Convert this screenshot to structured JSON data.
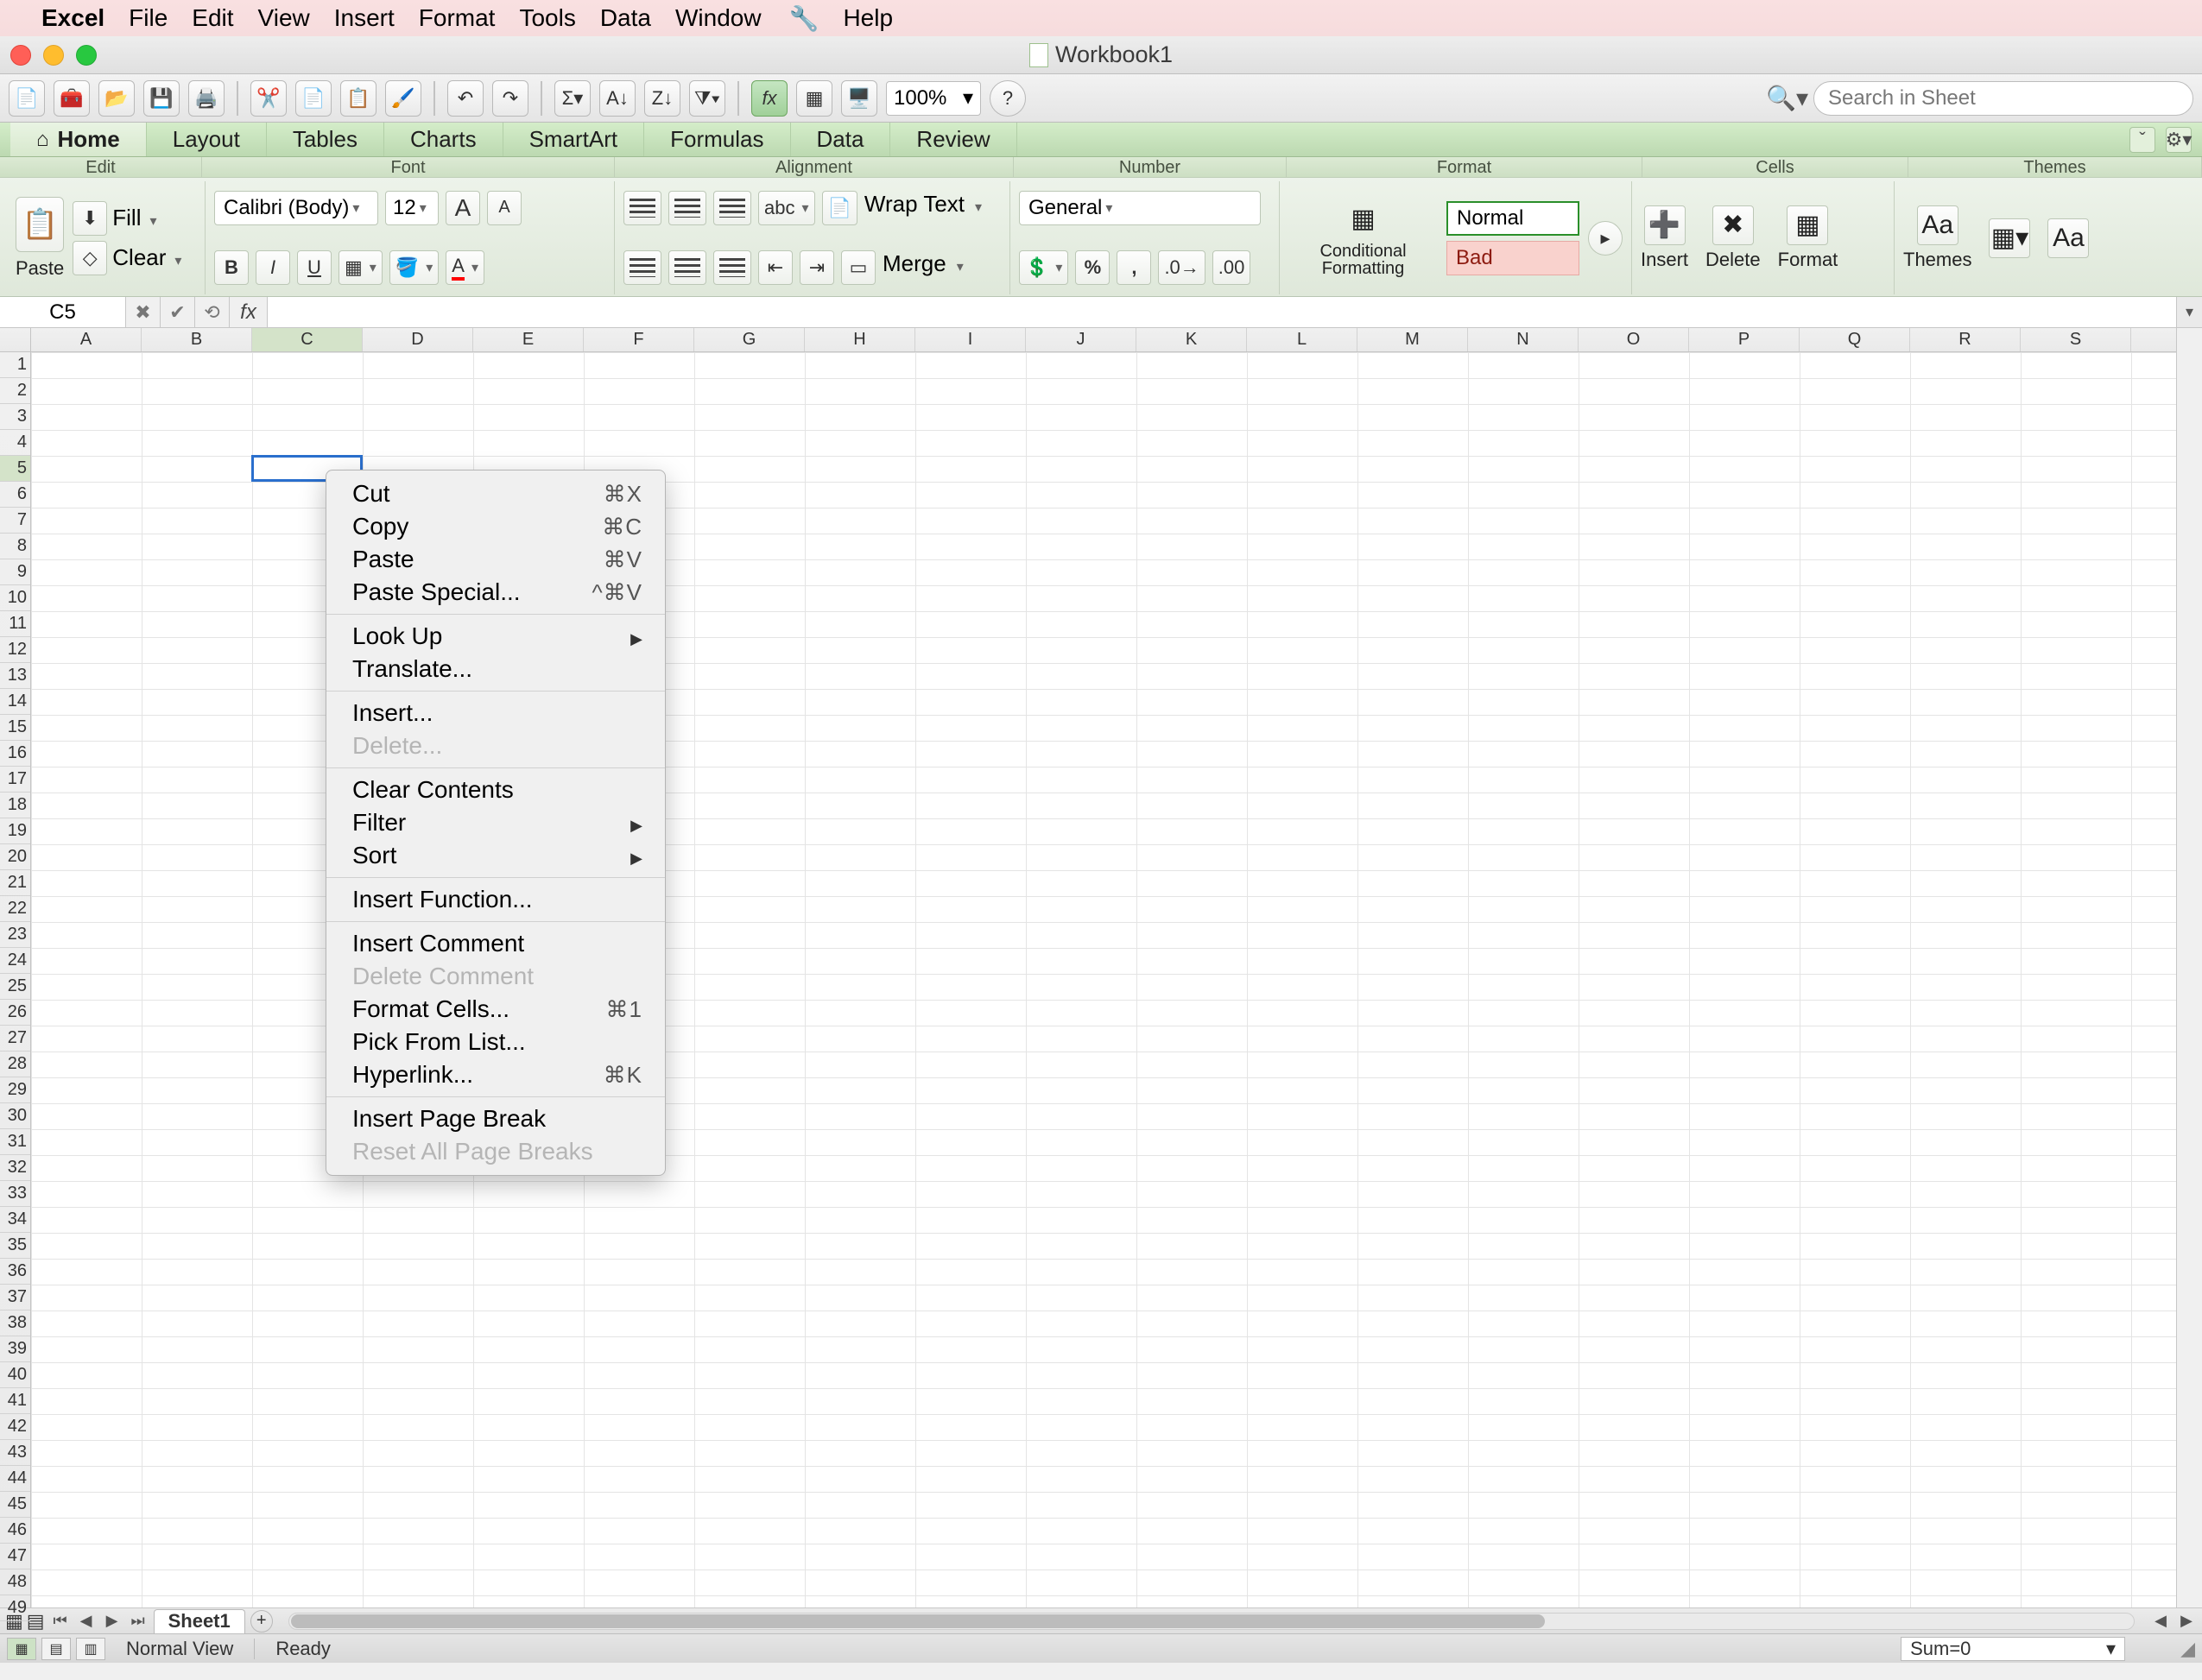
{
  "menubar": {
    "app": "Excel",
    "items": [
      "File",
      "Edit",
      "View",
      "Insert",
      "Format",
      "Tools",
      "Data",
      "Window"
    ],
    "help": "Help"
  },
  "window": {
    "title": "Workbook1"
  },
  "toolbar": {
    "zoom": "100%",
    "search_placeholder": "Search in Sheet"
  },
  "ribbon": {
    "tabs": [
      "Home",
      "Layout",
      "Tables",
      "Charts",
      "SmartArt",
      "Formulas",
      "Data",
      "Review"
    ],
    "active": "Home",
    "groups": {
      "edit": "Edit",
      "font": "Font",
      "alignment": "Alignment",
      "number": "Number",
      "format": "Format",
      "cells": "Cells",
      "themes": "Themes"
    },
    "edit": {
      "paste": "Paste",
      "fill": "Fill",
      "clear": "Clear"
    },
    "font": {
      "name": "Calibri (Body)",
      "size": "12"
    },
    "alignment": {
      "wrap": "Wrap Text",
      "merge": "Merge"
    },
    "number": {
      "format": "General"
    },
    "format": {
      "conditional": "Conditional Formatting",
      "normal": "Normal",
      "bad": "Bad"
    },
    "cells": {
      "insert": "Insert",
      "delete": "Delete",
      "format": "Format"
    },
    "themes": {
      "themes": "Themes",
      "aa": "Aa"
    }
  },
  "formula": {
    "name_box": "C5",
    "fx": "fx"
  },
  "grid": {
    "columns": [
      "A",
      "B",
      "C",
      "D",
      "E",
      "F",
      "G",
      "H",
      "I",
      "J",
      "K",
      "L",
      "M",
      "N",
      "O",
      "P",
      "Q",
      "R",
      "S"
    ],
    "rows": 49,
    "selected_cell": "C5",
    "sel_col_idx": 2,
    "sel_row_idx": 4
  },
  "context_menu": {
    "items": [
      {
        "label": "Cut",
        "shortcut": "⌘X"
      },
      {
        "label": "Copy",
        "shortcut": "⌘C"
      },
      {
        "label": "Paste",
        "shortcut": "⌘V"
      },
      {
        "label": "Paste Special...",
        "shortcut": "^⌘V"
      },
      {
        "type": "sep"
      },
      {
        "label": "Look Up",
        "submenu": true
      },
      {
        "label": "Translate..."
      },
      {
        "type": "sep"
      },
      {
        "label": "Insert..."
      },
      {
        "label": "Delete...",
        "disabled": true
      },
      {
        "type": "sep"
      },
      {
        "label": "Clear Contents"
      },
      {
        "label": "Filter",
        "submenu": true
      },
      {
        "label": "Sort",
        "submenu": true
      },
      {
        "type": "sep"
      },
      {
        "label": "Insert Function..."
      },
      {
        "type": "sep"
      },
      {
        "label": "Insert Comment"
      },
      {
        "label": "Delete Comment",
        "disabled": true
      },
      {
        "label": "Format Cells...",
        "shortcut": "⌘1"
      },
      {
        "label": "Pick From List..."
      },
      {
        "label": "Hyperlink...",
        "shortcut": "⌘K"
      },
      {
        "type": "sep"
      },
      {
        "label": "Insert Page Break"
      },
      {
        "label": "Reset All Page Breaks",
        "disabled": true
      }
    ]
  },
  "sheets": {
    "tabs": [
      "Sheet1"
    ]
  },
  "status": {
    "view": "Normal View",
    "state": "Ready",
    "sum": "Sum=0"
  }
}
